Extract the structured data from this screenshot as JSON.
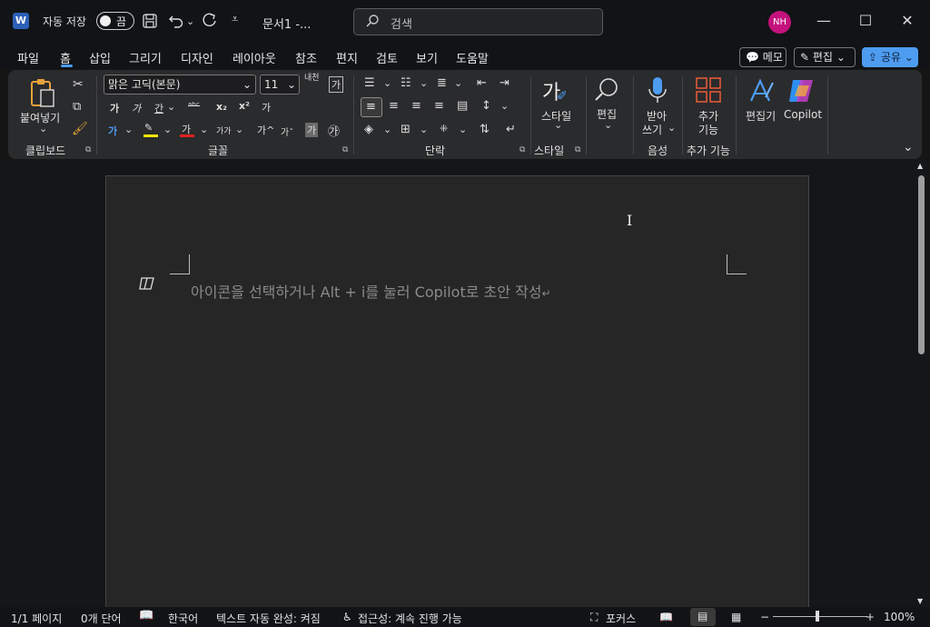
{
  "titlebar": {
    "app_logo": "W",
    "autosave_label": "자동 저장",
    "autosave_state": "끔",
    "doc_title": "문서1  -...",
    "search_placeholder": "검색",
    "avatar_initials": "NH",
    "avatar_color": "#c4127c",
    "minimize_glyph": "—",
    "maximize_glyph": "☐",
    "close_glyph": "✕"
  },
  "menu": {
    "tabs": [
      "파일",
      "홈",
      "삽입",
      "그리기",
      "디자인",
      "레이아웃",
      "참조",
      "편지",
      "검토",
      "보기",
      "도움말"
    ],
    "active_tab": "홈",
    "comment_button": "메모",
    "edit_button": "편집",
    "share_button": "공유",
    "accent_color": "#4d9cf0"
  },
  "ribbon": {
    "clipboard": {
      "paste_label": "붙여넣기",
      "group_label": "클립보드"
    },
    "font": {
      "font_name": "맑은 고딕(본문)",
      "font_size": "11",
      "ruby_label": "내천",
      "char_border": "가",
      "bold": "가",
      "italic": "가",
      "underline": "간",
      "strike": "ᵃᵇᶜ",
      "subscript": "x₂",
      "superscript": "x²",
      "clear_format": "가",
      "highlight": "✎",
      "font_color": "가",
      "change_case": "가가",
      "grow": "가^",
      "shrink": "가ˇ",
      "shading": "가",
      "enclose": "㉮",
      "group_label": "글꼴"
    },
    "paragraph": {
      "group_label": "단락"
    },
    "styles": {
      "style_label": "스타일",
      "group_label": "스타일"
    },
    "editing": {
      "edit_label": "편집"
    },
    "voice": {
      "dictate_line1": "받아",
      "dictate_line2": "쓰기",
      "group_label": "음성"
    },
    "addins": {
      "line1": "추가",
      "line2": "기능",
      "group_label": "추가 기능"
    },
    "editor": {
      "label": "편집기"
    },
    "copilot": {
      "label": "Copilot"
    }
  },
  "document": {
    "copilot_hint": "아이콘을 선택하거나 Alt + i를 눌러 Copilot로 초안 작성",
    "paragraph_mark": "↵",
    "ibeam": "I"
  },
  "status": {
    "page": "1/1 페이지",
    "words": "0개 단어",
    "language": "한국어",
    "autocomplete": "텍스트 자동 완성: 켜짐",
    "accessibility": "접근성: 계속 진행 가능",
    "focus": "포커스",
    "zoom_minus": "−",
    "zoom_plus": "+",
    "zoom": "100%"
  }
}
